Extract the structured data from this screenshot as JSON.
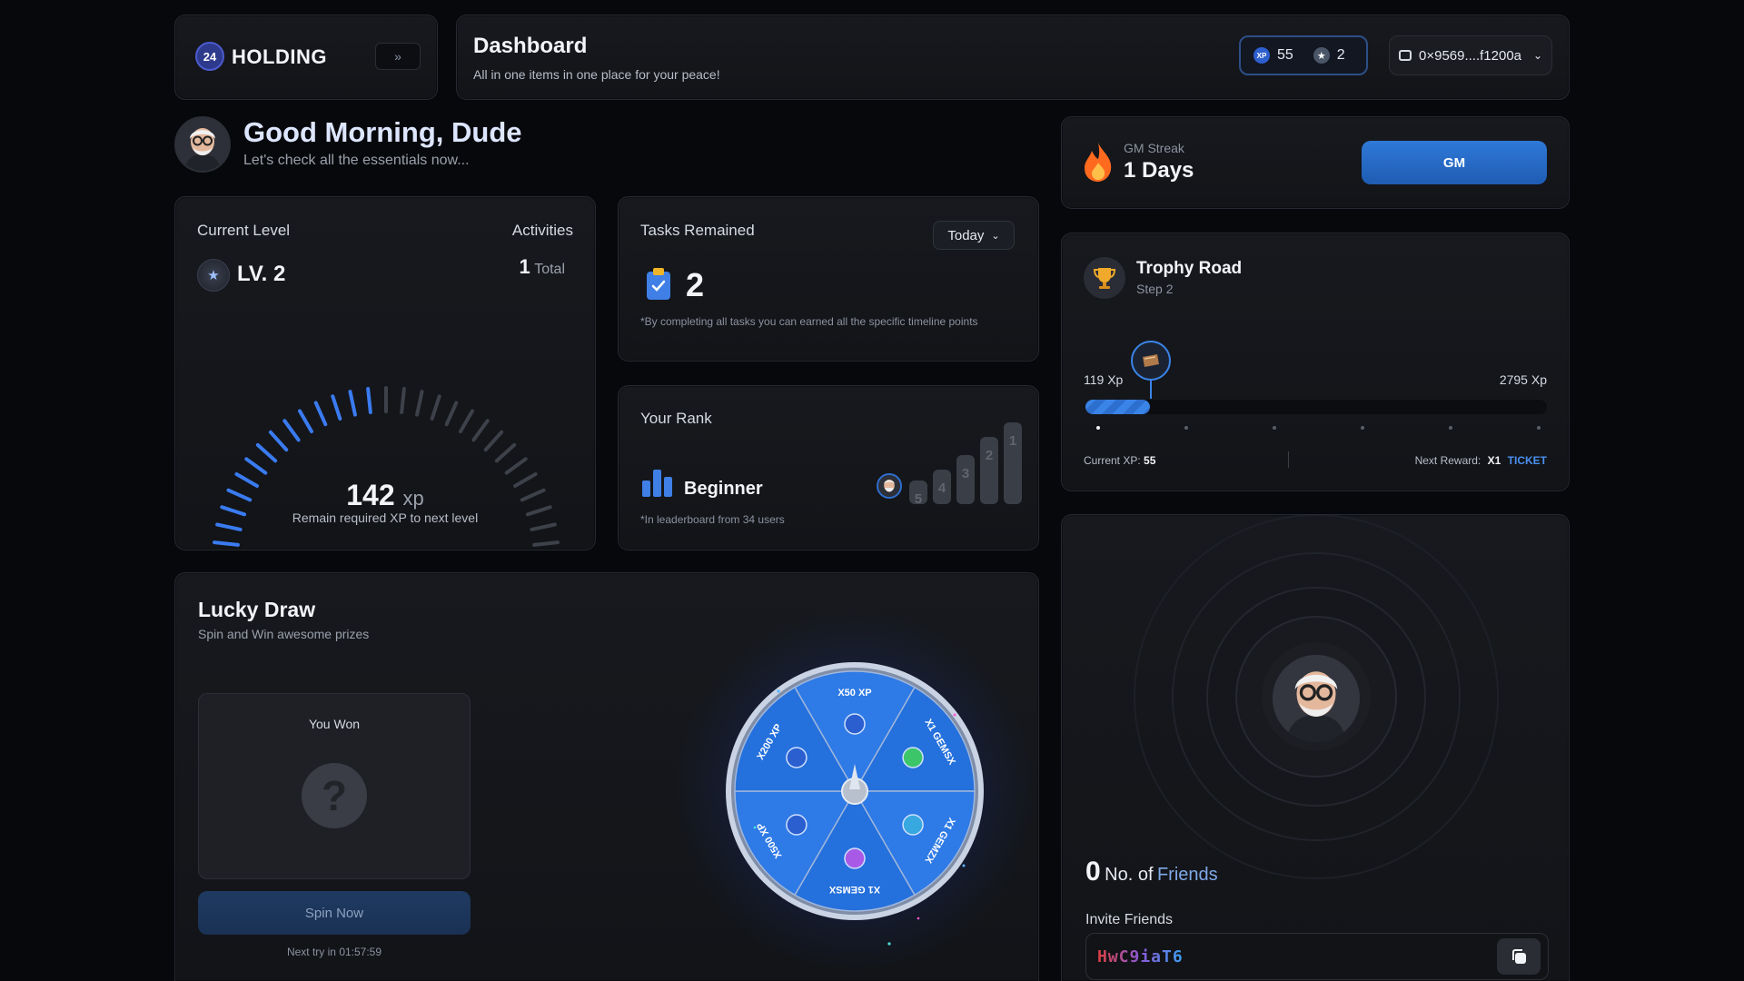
{
  "brand": {
    "logo_mark": "24",
    "name": "HOLDING",
    "collapse_icon": "chevrons-right-icon"
  },
  "header": {
    "title": "Dashboard",
    "subtitle": "All in one items in one place for your peace!",
    "xp_count": "55",
    "xp_icon_label": "XP",
    "star_count": "2",
    "wallet": "0×9569....f1200a"
  },
  "greeting": {
    "title": "Good Morning, Dude",
    "subtitle": "Let's check all the essentials now..."
  },
  "gm_streak": {
    "label": "GM Streak",
    "days": "1 Days",
    "button": "GM"
  },
  "level": {
    "label": "Current Level",
    "level": "LV. 2",
    "activities_label": "Activities",
    "activities_count": "1",
    "activities_unit": "Total",
    "xp_remaining": "142",
    "xp_unit": "xp",
    "xp_caption": "Remain required XP to next level",
    "gauge_progress": 0.48
  },
  "tasks": {
    "label": "Tasks Remained",
    "filter": "Today",
    "count": "2",
    "note": "*By completing all tasks you can earned all the specific timeline points"
  },
  "rank": {
    "label": "Your Rank",
    "rank": "Beginner",
    "note": "*In leaderboard from 34 users",
    "positions": [
      "5",
      "4",
      "3",
      "2",
      "1"
    ]
  },
  "trophy": {
    "title": "Trophy Road",
    "step": "Step 2",
    "min_xp": "119 Xp",
    "max_xp": "2795 Xp",
    "progress": 0.14,
    "current_xp_label": "Current XP:",
    "current_xp": "55",
    "next_reward_label": "Next Reward:",
    "next_reward_qty": "X1",
    "next_reward_item": "TICKET"
  },
  "lucky_draw": {
    "title": "Lucky Draw",
    "subtitle": "Spin and Win awesome prizes",
    "won_label": "You Won",
    "won_placeholder": "?",
    "spin_button": "Spin Now",
    "next_try": "Next try in 01:57:59",
    "wheel_segments": [
      "X50 XP",
      "X1 GEMSX",
      "X1 GEMZX",
      "X1 GEMSX",
      "X500 XP",
      "X200 XP"
    ],
    "wheel_xp_icon": "XP"
  },
  "friends": {
    "count": "0",
    "label_prefix": "No. of",
    "label_highlight": "Friends",
    "invite_label": "Invite Friends",
    "invite_code": "HwC9iaT6"
  },
  "colors": {
    "accent": "#2f79d8",
    "background": "#07080b",
    "card": "#15171b"
  }
}
